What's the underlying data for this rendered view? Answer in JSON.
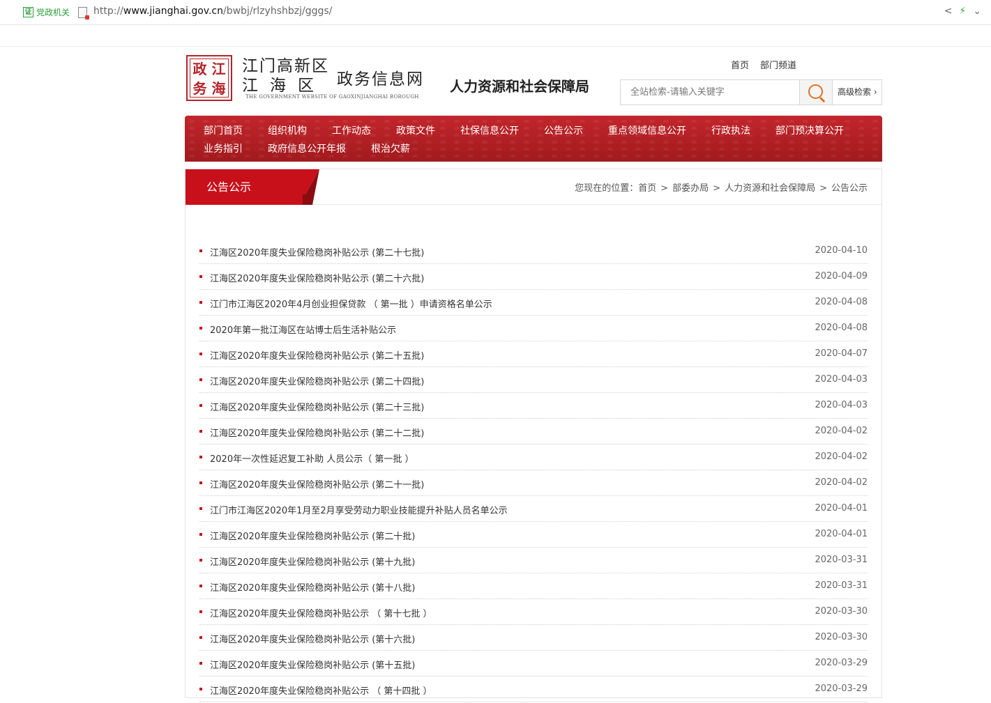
{
  "browser": {
    "cert_label": "党政机关",
    "cert_badge": "证",
    "url_prefix": "http://",
    "url_host": "www.jianghai.gov.cn",
    "url_path": "/bwbj/rlzyhshbzj/gggs/"
  },
  "header": {
    "seal_chars": [
      "政",
      "江",
      "务",
      "海"
    ],
    "logo_line1": "江门高新区",
    "logo_line2": "江海区",
    "logo_big": "政务信息网",
    "logo_en": "THE GOVERNMENT WEBSITE OF GAOXINJIANGHAI BOROUGH",
    "dept_title": "人力资源和社会保障局",
    "links": [
      "首页",
      "部门频道"
    ],
    "search_placeholder": "全站检索-请输入关键字",
    "advanced_search": "高级检索"
  },
  "nav": {
    "items": [
      "部门首页",
      "组织机构",
      "工作动态",
      "政策文件",
      "社保信息公开",
      "公告公示",
      "重点领域信息公开",
      "行政执法",
      "部门预决算公开",
      "业务指引",
      "政府信息公开年报",
      "根治欠薪"
    ]
  },
  "section": {
    "tab_title": "公告公示",
    "crumb_label": "您现在的位置：",
    "crumb": [
      "首页",
      "部委办局",
      "人力资源和社会保障局",
      "公告公示"
    ]
  },
  "notices": [
    {
      "title": "江海区2020年度失业保险稳岗补贴公示 (第二十七批)",
      "date": "2020-04-10"
    },
    {
      "title": "江海区2020年度失业保险稳岗补贴公示 (第二十六批)",
      "date": "2020-04-09"
    },
    {
      "title": "江门市江海区2020年4月创业担保贷款 （ 第一批 ）申请资格名单公示",
      "date": "2020-04-08"
    },
    {
      "title": "2020年第一批江海区在站博士后生活补贴公示",
      "date": "2020-04-08"
    },
    {
      "title": "江海区2020年度失业保险稳岗补贴公示 (第二十五批)",
      "date": "2020-04-07"
    },
    {
      "title": "江海区2020年度失业保险稳岗补贴公示 (第二十四批)",
      "date": "2020-04-03"
    },
    {
      "title": "江海区2020年度失业保险稳岗补贴公示 (第二十三批)",
      "date": "2020-04-03"
    },
    {
      "title": "江海区2020年度失业保险稳岗补贴公示 (第二十二批)",
      "date": "2020-04-02"
    },
    {
      "title": "2020年一次性延迟复工补助 人员公示（ 第一批 ）",
      "date": "2020-04-02"
    },
    {
      "title": "江海区2020年度失业保险稳岗补贴公示 (第二十一批)",
      "date": "2020-04-02"
    },
    {
      "title": "江门市江海区2020年1月至2月享受劳动力职业技能提升补贴人员名单公示",
      "date": "2020-04-01"
    },
    {
      "title": "江海区2020年度失业保险稳岗补贴公示 (第二十批)",
      "date": "2020-04-01"
    },
    {
      "title": "江海区2020年度失业保险稳岗补贴公示 (第十九批)",
      "date": "2020-03-31"
    },
    {
      "title": "江海区2020年度失业保险稳岗补贴公示 (第十八批)",
      "date": "2020-03-31"
    },
    {
      "title": "江海区2020年度失业保险稳岗补贴公示 （ 第十七批 ）",
      "date": "2020-03-30"
    },
    {
      "title": "江海区2020年度失业保险稳岗补贴公示 (第十六批)",
      "date": "2020-03-30"
    },
    {
      "title": "江海区2020年度失业保险稳岗补贴公示 (第十五批)",
      "date": "2020-03-29"
    },
    {
      "title": "江海区2020年度失业保险稳岗补贴公示 （ 第十四批 ）",
      "date": "2020-03-29"
    }
  ],
  "colors": {
    "nav_red": "#b01f23",
    "tab_red": "#c8101a",
    "seal_red": "#b3242a"
  }
}
